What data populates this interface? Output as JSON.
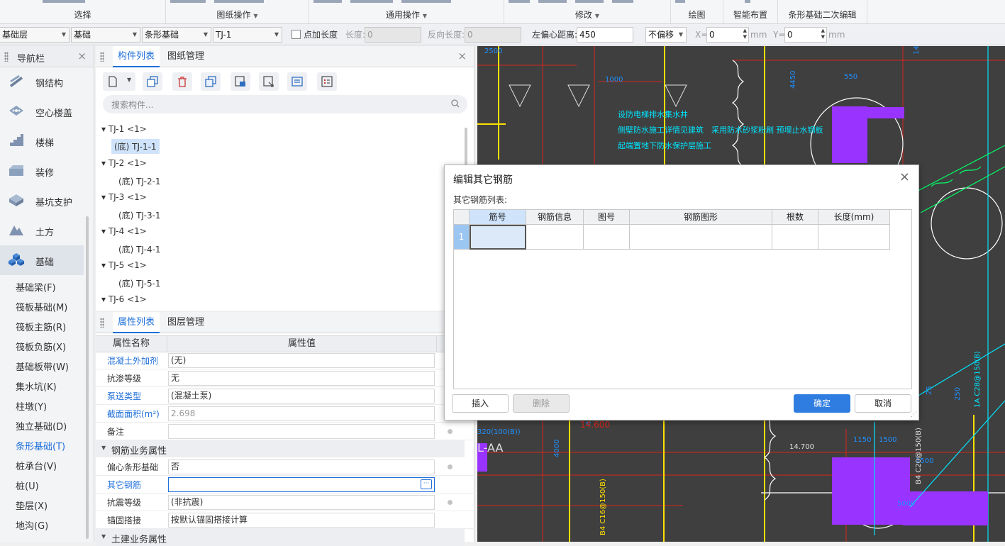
{
  "ribbon": {
    "groups": [
      {
        "label": "选择",
        "dropdown": false
      },
      {
        "label": "图纸操作",
        "dropdown": true
      },
      {
        "label": "通用操作",
        "dropdown": true
      },
      {
        "label": "修改",
        "dropdown": true
      },
      {
        "label": "绘图",
        "dropdown": false
      },
      {
        "label": "智能布置",
        "dropdown": false
      },
      {
        "label": "条形基础二次编辑",
        "dropdown": false
      }
    ]
  },
  "filterbar": {
    "layer": "基础层",
    "category": "基础",
    "type": "条形基础",
    "component": "TJ-1",
    "point_length_label": "点加长度",
    "length_label": "长度:",
    "length_value": "0",
    "reverse_length_label": "反向长度:",
    "reverse_length_value": "0",
    "left_offset_label": "左偏心距离:",
    "left_offset_value": "450",
    "offset_mode": "不偏移",
    "x_label": "X=",
    "x_value": "0",
    "y_label": "Y=",
    "y_value": "0",
    "unit": "mm"
  },
  "nav": {
    "title": "导航栏",
    "categories": [
      {
        "label": "钢结构",
        "icon": "steel-structure-icon"
      },
      {
        "label": "空心楼盖",
        "icon": "hollow-floor-icon"
      },
      {
        "label": "楼梯",
        "icon": "stairs-icon"
      },
      {
        "label": "装修",
        "icon": "decoration-icon"
      },
      {
        "label": "基坑支护",
        "icon": "pit-support-icon"
      },
      {
        "label": "土方",
        "icon": "earthwork-icon"
      },
      {
        "label": "基础",
        "icon": "foundation-icon"
      }
    ],
    "subitems": [
      "基础梁(F)",
      "筏板基础(M)",
      "筏板主筋(R)",
      "筏板负筋(X)",
      "基础板带(W)",
      "集水坑(K)",
      "柱墩(Y)",
      "独立基础(D)",
      "条形基础(T)",
      "桩承台(V)",
      "桩(U)",
      "垫层(X)",
      "地沟(G)"
    ]
  },
  "complist": {
    "tabs": [
      "构件列表",
      "图纸管理"
    ],
    "search_placeholder": "搜索构件...",
    "tree": [
      {
        "parent": "TJ-1 <1>",
        "child": "(底) TJ-1-1"
      },
      {
        "parent": "TJ-2 <1>",
        "child": "(底) TJ-2-1"
      },
      {
        "parent": "TJ-3 <1>",
        "child": "(底) TJ-3-1"
      },
      {
        "parent": "TJ-4 <1>",
        "child": "(底) TJ-4-1"
      },
      {
        "parent": "TJ-5 <1>",
        "child": "(底) TJ-5-1"
      },
      {
        "parent": "TJ-6 <1>",
        "child": ""
      }
    ]
  },
  "props": {
    "tabs": [
      "属性列表",
      "图层管理"
    ],
    "col_name": "属性名称",
    "col_value": "属性值",
    "rows": [
      {
        "name": "混凝土外加剂",
        "value": "(无)"
      },
      {
        "name": "抗渗等级",
        "value": "无"
      },
      {
        "name": "泵送类型",
        "value": "(混凝土泵)"
      },
      {
        "name": "截面面积(m²)",
        "value": "2.698"
      },
      {
        "name": "备注",
        "value": ""
      }
    ],
    "section1": "钢筋业务属性",
    "rows2": [
      {
        "name": "偏心条形基础",
        "value": "否"
      },
      {
        "name": "其它钢筋",
        "value": ""
      },
      {
        "name": "抗震等级",
        "value": "(非抗震)"
      },
      {
        "name": "锚固搭接",
        "value": "按默认锚固搭接计算"
      }
    ],
    "section2": "土建业务属性"
  },
  "dialog": {
    "title": "编辑其它钢筋",
    "subtitle": "其它钢筋列表:",
    "columns": [
      "筋号",
      "钢筋信息",
      "图号",
      "钢筋图形",
      "根数",
      "长度(mm)"
    ],
    "row_number": "1",
    "buttons": {
      "insert": "插入",
      "delete": "删除",
      "ok": "确定",
      "cancel": "取消"
    }
  },
  "cad": {
    "labels": [
      "2500",
      "1000",
      "550",
      "4450",
      "14",
      "320(100(B))",
      "L-AA",
      "4000",
      "4000",
      "B4 C16@150(B)",
      "1150",
      "1500",
      "1500",
      "5000",
      "B4 C20@150(B)",
      "14.700",
      "14.600",
      "25",
      "250",
      "1A C28@150(B)"
    ],
    "annotations": [
      "设防电梯排水集水井",
      "侧壁防水施工详情见建筑",
      "采用防水砂浆粉刷  预埋止水钢板",
      "起端置地下防水保护层施工"
    ]
  }
}
